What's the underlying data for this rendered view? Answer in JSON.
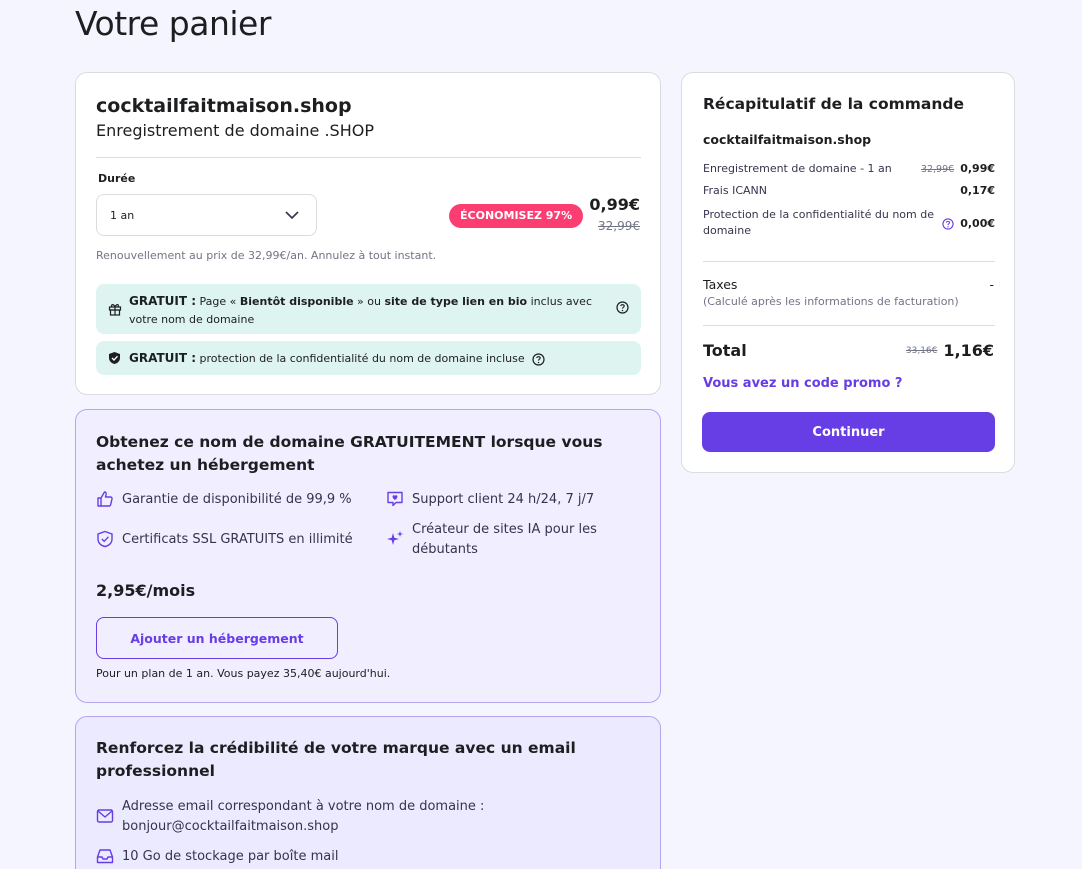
{
  "page": {
    "title": "Votre panier"
  },
  "domain_card": {
    "name": "cocktailfaitmaison.shop",
    "subtitle": "Enregistrement de domaine .SHOP",
    "duration_label": "Durée",
    "duration_value": "1 an",
    "save_badge": "ÉCONOMISEZ 97%",
    "price_now": "0,99€",
    "price_old": "32,99€",
    "renewal": "Renouvellement au prix de 32,99€/an. Annulez à tout instant.",
    "note1": {
      "free": "GRATUIT :",
      "part1": "Page « ",
      "bold1": "Bientôt disponible",
      "part2": " » ou ",
      "bold2": "site de type lien en bio",
      "part3": " inclus avec votre nom de domaine"
    },
    "note2": {
      "free": "GRATUIT :",
      "text": " protection de la confidentialité du nom de domaine incluse"
    }
  },
  "hosting_card": {
    "title": "Obtenez ce nom de domaine GRATUITEMENT lorsque vous achetez un hébergement",
    "features": [
      {
        "icon": "thumbs-up-icon",
        "text": "Garantie de disponibilité de 99,9 %"
      },
      {
        "icon": "support-chat-icon",
        "text": "Support client 24 h/24, 7 j/7"
      },
      {
        "icon": "shield-check-icon",
        "text": "Certificats SSL GRATUITS en illimité"
      },
      {
        "icon": "sparkles-icon",
        "text": "Créateur de sites IA pour les débutants"
      }
    ],
    "price": "2,95€/mois",
    "button": "Ajouter un hébergement",
    "note": "Pour un plan de 1 an. Vous payez 35,40€ aujourd'hui."
  },
  "email_card": {
    "title": "Renforcez la crédibilité de votre marque avec un email professionnel",
    "features": [
      {
        "icon": "mail-icon",
        "text": "Adresse email correspondant à votre nom de domaine : bonjour@cocktailfaitmaison.shop"
      },
      {
        "icon": "inbox-icon",
        "text": "10 Go de stockage par boîte mail"
      }
    ]
  },
  "summary": {
    "title": "Récapitulatif de la commande",
    "domain": "cocktailfaitmaison.shop",
    "rows": [
      {
        "label": "Enregistrement de domaine - 1 an",
        "old": "32,99€",
        "value": "0,99€"
      },
      {
        "label": "Frais ICANN",
        "value": "0,17€"
      },
      {
        "label": "Protection de la confidentialité du nom de domaine",
        "value": "0,00€"
      }
    ],
    "taxes_label": "Taxes",
    "taxes_sub": "(Calculé après les informations de facturation)",
    "taxes_value": "-",
    "total_label": "Total",
    "total_old": "33,16€",
    "total_value": "1,16€",
    "promo": "Vous avez un code promo ?",
    "continue": "Continuer"
  },
  "colors": {
    "accent": "#673de6",
    "badge": "#fc3d72",
    "note_bg": "#def4f0",
    "page_bg": "#f4f5ff"
  }
}
